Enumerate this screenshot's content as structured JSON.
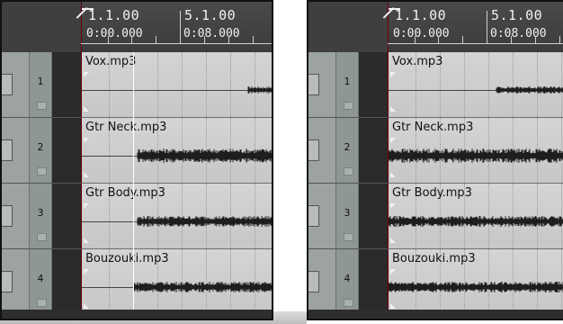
{
  "ruler": {
    "bar1": "1.1.00",
    "time1": "0:00.000",
    "bar2": "5.1.00",
    "time2": "0:08.000"
  },
  "tracks": [
    {
      "number": "1",
      "item": "Vox.mp3"
    },
    {
      "number": "2",
      "item": "Gtr Neck.mp3"
    },
    {
      "number": "3",
      "item": "Gtr Body.mp3"
    },
    {
      "number": "4",
      "item": "Bouzouki.mp3"
    }
  ],
  "colors": {
    "item_bg": "#cfcfcf",
    "tcp_bg": "#9da2a2",
    "ruler_bg": "#3f3f3f",
    "wave": "#1e1e1e"
  }
}
